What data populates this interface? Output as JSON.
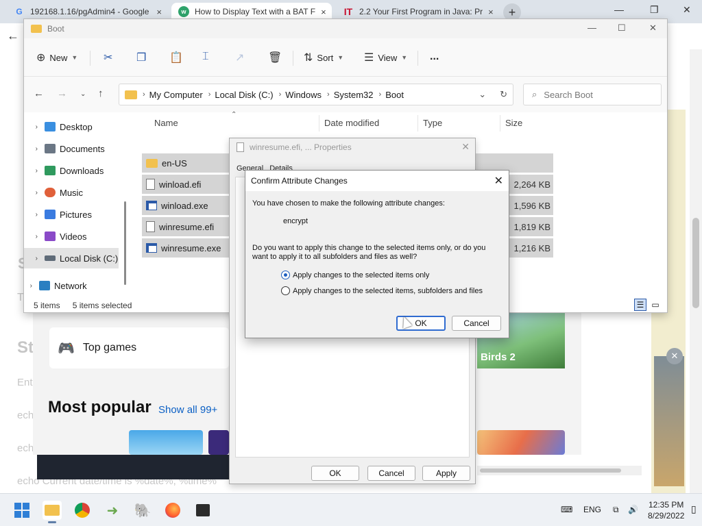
{
  "browser": {
    "tabs": [
      {
        "title": "192168.1.16/pgAdmin4 - Google",
        "icon": "google-icon"
      },
      {
        "title": "How to Display Text with a BAT F",
        "icon": "wikihow-icon"
      },
      {
        "title": "2.2 Your First Program in Java: Pr",
        "icon": "it-icon"
      }
    ],
    "close_glyph": "×",
    "new_tab": "+"
  },
  "page": {
    "lines": [
      "S",
      "T",
      "St",
      "Ent",
      "echo",
      "ech",
      "ech",
      "echo Current date/time is %date%, %time%"
    ],
    "store": {
      "top_games": "Top games",
      "most_popular": "Most popular",
      "show_all": "Show all 99+",
      "birds": "Birds 2"
    }
  },
  "explorer": {
    "title": "Boot",
    "toolbar": {
      "new": "New",
      "sort": "Sort",
      "view": "View",
      "more": "..."
    },
    "breadcrumb": [
      "My Computer",
      "Local Disk (C:)",
      "Windows",
      "System32",
      "Boot"
    ],
    "search_placeholder": "Search Boot",
    "nav": [
      {
        "label": "Desktop",
        "color": "#3a8fe0"
      },
      {
        "label": "Documents",
        "color": "#6b7785"
      },
      {
        "label": "Downloads",
        "color": "#2f9a5e"
      },
      {
        "label": "Music",
        "color": "#e0603a"
      },
      {
        "label": "Pictures",
        "color": "#3a7be0"
      },
      {
        "label": "Videos",
        "color": "#8a4ac8"
      },
      {
        "label": "Local Disk (C:)",
        "color": "#5f6b78"
      },
      {
        "label": "Network",
        "color": "#2a7fc1"
      }
    ],
    "columns": {
      "name": "Name",
      "date": "Date modified",
      "type": "Type",
      "size": "Size"
    },
    "files": [
      {
        "name": "en-US",
        "size": "",
        "kind": "folder"
      },
      {
        "name": "winload.efi",
        "size": "2,264 KB",
        "kind": "file"
      },
      {
        "name": "winload.exe",
        "size": "1,596 KB",
        "kind": "exe"
      },
      {
        "name": "winresume.efi",
        "size": "1,819 KB",
        "kind": "file"
      },
      {
        "name": "winresume.exe",
        "size": "1,216 KB",
        "kind": "exe"
      }
    ],
    "status": {
      "count": "5 items",
      "selected": "5 items selected"
    }
  },
  "properties": {
    "title": "winresume.efi, ... Properties",
    "tab_general": "General",
    "tab_details": "Details",
    "ok": "OK",
    "cancel": "Cancel",
    "apply": "Apply"
  },
  "confirm": {
    "title": "Confirm Attribute Changes",
    "intro": "You have chosen to make the following attribute changes:",
    "change": "encrypt",
    "question_1": "Do you want to apply this change to the selected items only, or do you",
    "question_2": "want to apply it to all subfolders and files as well?",
    "option_selected_only": "Apply changes to the selected items only",
    "option_subfolders": "Apply changes to the selected items, subfolders and files",
    "selected_option": "selected-only",
    "ok": "OK",
    "cancel": "Cancel"
  },
  "taskbar": {
    "language": "ENG",
    "time": "12:35 PM",
    "date": "8/29/2022"
  }
}
